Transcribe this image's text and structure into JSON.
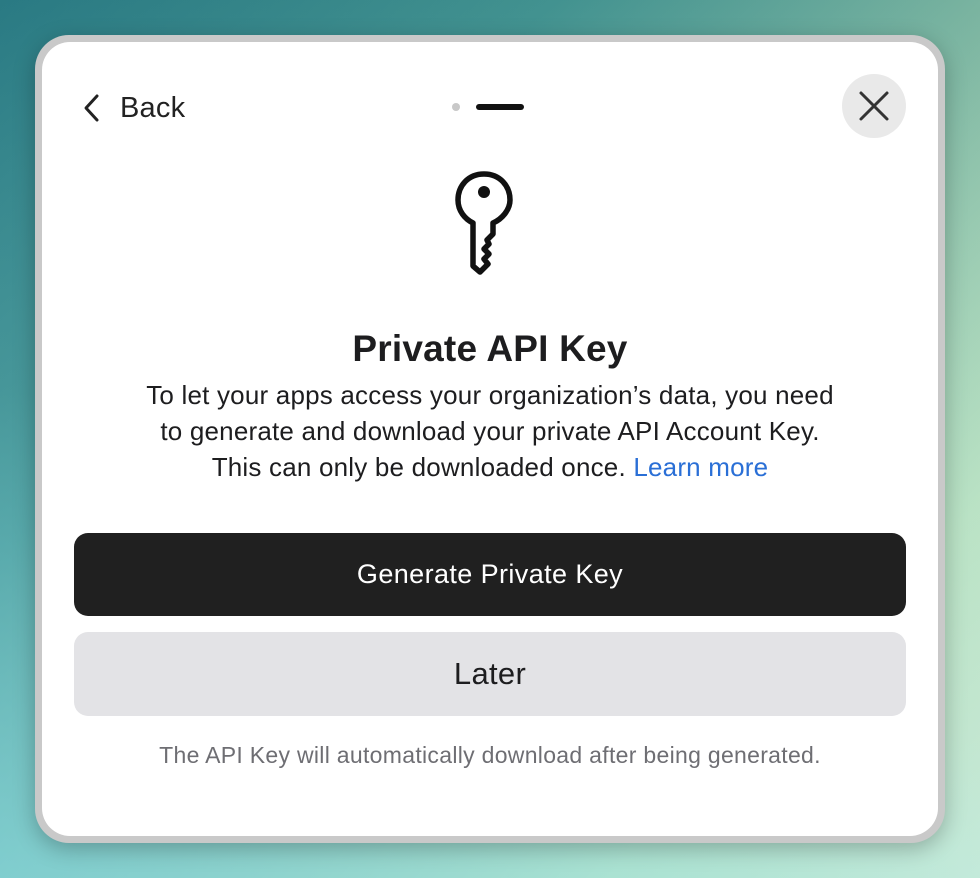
{
  "header": {
    "back_label": "Back",
    "back_icon": "chevron-left-icon",
    "close_icon": "close-icon",
    "pager": {
      "total_steps": 2,
      "current_step": 2
    }
  },
  "content": {
    "icon": "key-icon",
    "title": "Private API Key",
    "description_line1": "To let your apps access your organization’s data, you need",
    "description_line2": "to generate and download your private API Account Key.",
    "description_line3": "This can only be downloaded once.",
    "learn_more": "Learn more"
  },
  "actions": {
    "primary_label": "Generate Private Key",
    "secondary_label": "Later"
  },
  "footnote": "The API Key will automatically download after being generated.",
  "colors": {
    "primary_button": "#202020",
    "secondary_button": "#e3e3e6",
    "link": "#2a6fd6"
  }
}
